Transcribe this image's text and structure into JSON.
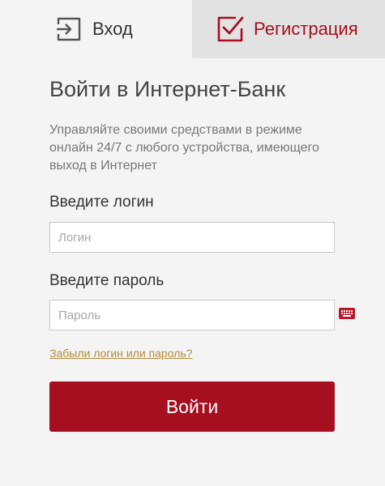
{
  "tabs": {
    "login": {
      "label": "Вход",
      "icon": "login-arrow-icon"
    },
    "register": {
      "label": "Регистрация",
      "icon": "checkbox-check-icon"
    }
  },
  "main": {
    "title": "Войти в Интернет-Банк",
    "subtitle": "Управляйте своими средствами в режиме онлайн 24/7 с любого устройства, имеющего выход в Интернет"
  },
  "form": {
    "login_label": "Введите логин",
    "login_placeholder": "Логин",
    "login_value": "",
    "password_label": "Введите пароль",
    "password_placeholder": "Пароль",
    "password_value": "",
    "keyboard_icon": "virtual-keyboard-icon",
    "forgot_link": "Забыли логин или пароль?",
    "submit_label": "Войти"
  },
  "colors": {
    "brand_red": "#a50f1f",
    "link_gold": "#b28a3e",
    "active_tab_bg": "#f4f4f4",
    "inactive_tab_bg": "#e2e2e2"
  }
}
